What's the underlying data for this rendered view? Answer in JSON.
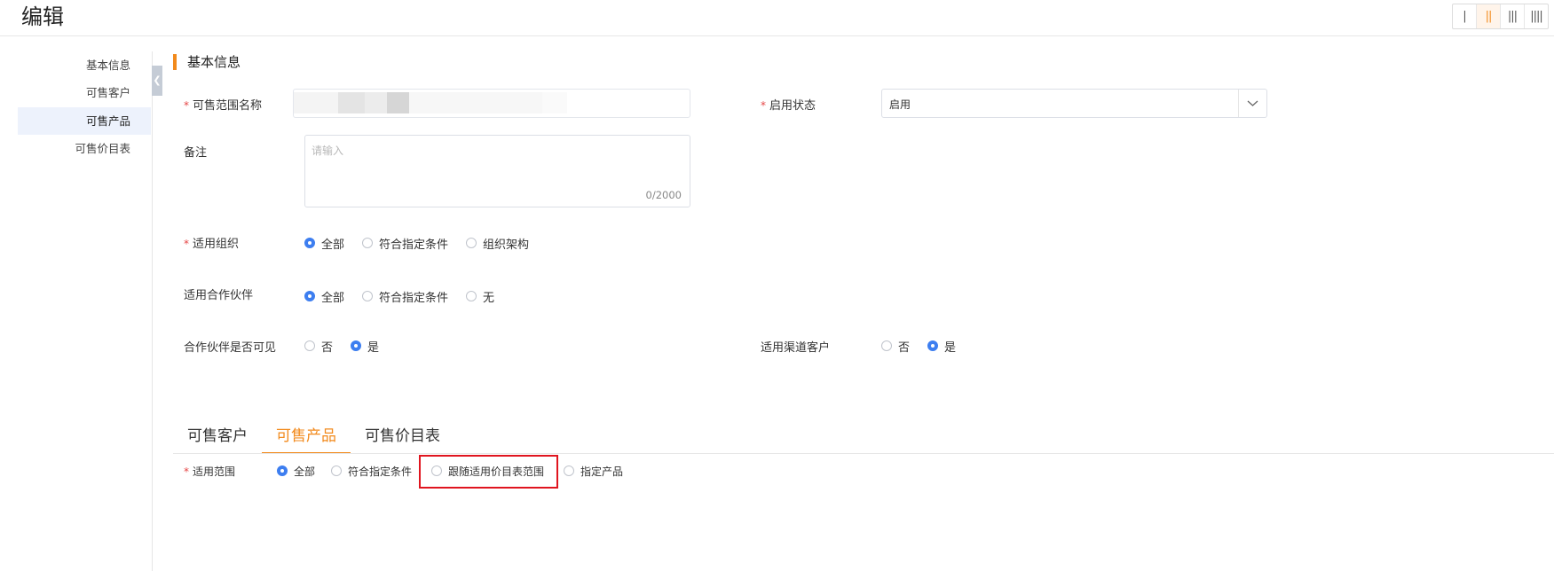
{
  "header": {
    "title": "编辑",
    "layout_options": [
      "|",
      "||",
      "|||",
      "||||"
    ],
    "active_layout": 1
  },
  "sidebar": {
    "items": [
      {
        "label": "基本信息",
        "active": false
      },
      {
        "label": "可售客户",
        "active": false
      },
      {
        "label": "可售产品",
        "active": true
      },
      {
        "label": "可售价目表",
        "active": false
      }
    ],
    "collapse_icon": "chevron-left-icon"
  },
  "basic_info": {
    "section_title": "基本信息",
    "range_name": {
      "label": "可售范围名称",
      "value": ""
    },
    "status": {
      "label": "启用状态",
      "value": "启用",
      "icon": "chevron-down-icon"
    },
    "remark": {
      "label": "备注",
      "placeholder": "请输入",
      "counter": "0/2000"
    },
    "org": {
      "label": "适用组织",
      "options": [
        "全部",
        "符合指定条件",
        "组织架构"
      ],
      "selected": 0
    },
    "partner": {
      "label": "适用合作伙伴",
      "options": [
        "全部",
        "符合指定条件",
        "无"
      ],
      "selected": 0
    },
    "partner_visible": {
      "label": "合作伙伴是否可见",
      "options": [
        "否",
        "是"
      ],
      "selected": 1
    },
    "channel_customer": {
      "label": "适用渠道客户",
      "options": [
        "否",
        "是"
      ],
      "selected": 1
    }
  },
  "tabs": {
    "items": [
      "可售客户",
      "可售产品",
      "可售价目表"
    ],
    "active": 1
  },
  "product_scope": {
    "label": "适用范围",
    "options": [
      "全部",
      "符合指定条件",
      "跟随适用价目表范围",
      "指定产品"
    ],
    "selected": 0
  },
  "colors": {
    "accent": "#f28a1c",
    "radio_checked": "#3d7ef0",
    "required": "#e54545",
    "highlight": "#e0151f",
    "sidebar_active_bg": "#edf2fc"
  }
}
